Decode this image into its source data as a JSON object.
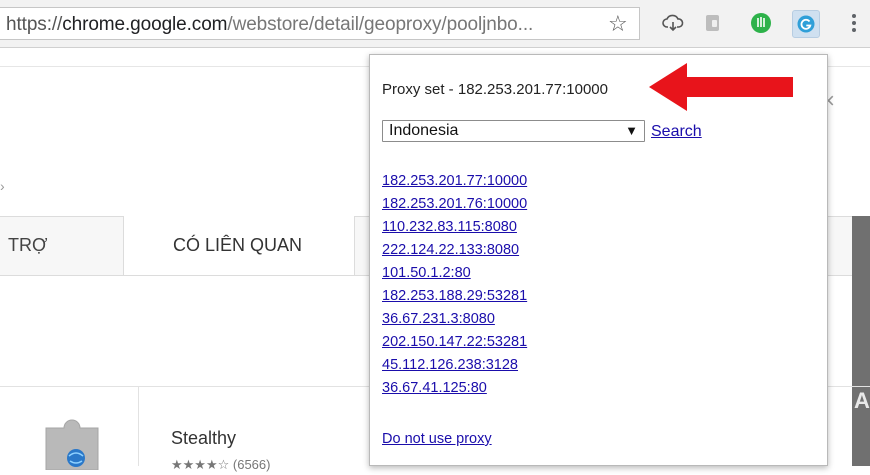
{
  "browser": {
    "url_scheme": "https://",
    "url_host": "chrome.google.com",
    "url_path": "/webstore/detail/geoproxy/pooljnbo...",
    "bookmark_icon": "star-icon",
    "extensions": [
      {
        "name": "cloud-download-icon"
      },
      {
        "name": "evernote-icon"
      },
      {
        "name": "green-leaf-icon"
      },
      {
        "name": "geoproxy-icon"
      }
    ],
    "menu_icon": "kebab-menu-icon"
  },
  "page": {
    "tab_left_label": "TRỢ",
    "tab_related_label": "CÓ LIÊN QUAN",
    "item_title": "Stealthy",
    "item_rating": "★★★★☆ (6566)",
    "side_letter": "A"
  },
  "popup": {
    "status_text": "Proxy set - 182.253.201.77:10000",
    "country_selected": "Indonesia",
    "search_label": "Search",
    "proxies": [
      "182.253.201.77:10000",
      "182.253.201.76:10000",
      "110.232.83.115:8080",
      "222.124.22.133:8080",
      "101.50.1.2:80",
      "182.253.188.29:53281",
      "36.67.231.3:8080",
      "202.150.147.22:53281",
      "45.112.126.238:3128",
      "36.67.41.125:80"
    ],
    "no_proxy_label": "Do not use proxy"
  },
  "colors": {
    "link": "#1a0dab",
    "arrow": "#e8141b",
    "ext_active_bg": "#cfe0f0"
  }
}
